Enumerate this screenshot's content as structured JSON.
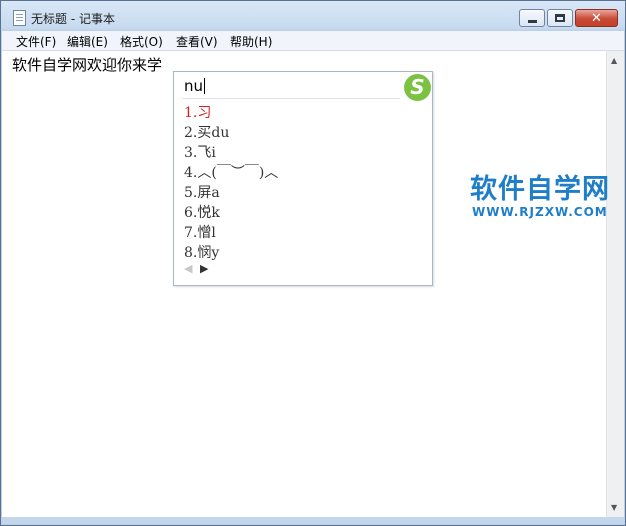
{
  "window": {
    "title": "无标题 - 记事本",
    "close_glyph": "✕"
  },
  "menu": {
    "items": [
      "文件(F)",
      "编辑(E)",
      "格式(O)",
      "查看(V)",
      "帮助(H)"
    ]
  },
  "editor": {
    "text": "软件自学网欢迎你来学"
  },
  "ime": {
    "input": "nu",
    "logo_text": "S",
    "candidates": [
      "1.习",
      "2.买du",
      "3.飞i",
      "4.︿(￣︶￣)︿",
      "5.屏a",
      "6.悦k",
      "7.憎l",
      "8.悯y"
    ],
    "nav_prev": "◀",
    "nav_next": "▶"
  },
  "watermark": {
    "title": "软件自学网",
    "url": "WWW.RJZXW.COM"
  },
  "scrollbar": {
    "up": "▲",
    "down": "▼"
  },
  "colors": {
    "accent_red": "#d32121",
    "watermark_blue": "#1f7ec8",
    "ime_logo_green": "#7cc242"
  }
}
